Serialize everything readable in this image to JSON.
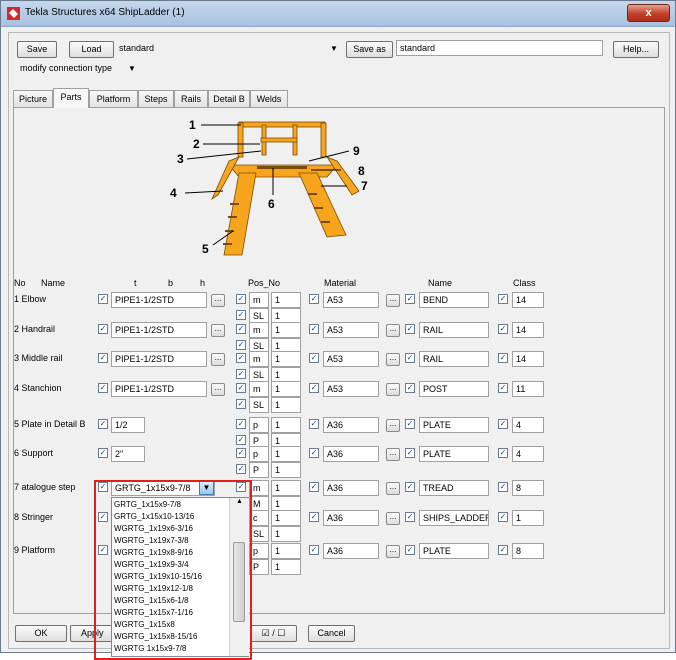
{
  "window": {
    "title": "Tekla Structures x64  ShipLadder (1)",
    "close_label": "x"
  },
  "toolbar": {
    "save_label": "Save",
    "load_label": "Load",
    "load_value": "standard",
    "save_as_label": "Save as",
    "save_as_value": "standard",
    "help_label": "Help...",
    "mode_value": "modify connection type"
  },
  "tabs": [
    "Picture",
    "Parts",
    "Platform",
    "Steps",
    "Rails",
    "Detail B",
    "Welds"
  ],
  "active_tab": "Parts",
  "diagram_labels": [
    "1",
    "2",
    "3",
    "4",
    "5",
    "6",
    "7",
    "8",
    "9"
  ],
  "headers": {
    "no": "No",
    "name": "Name",
    "t": "t",
    "b": "b",
    "h": "h",
    "pos_no": "Pos_No",
    "material": "Material",
    "part_name": "Name",
    "class": "Class"
  },
  "check_mark": "✓",
  "dots_label": "...",
  "rows": [
    {
      "label": "1 Elbow",
      "profile": "PIPE1-1/2STD",
      "p1": "m",
      "n1": "1",
      "p2": "SL",
      "n2": "1",
      "material": "A53",
      "name": "BEND",
      "class": "14"
    },
    {
      "label": "2 Handrail",
      "profile": "PIPE1-1/2STD",
      "p1": "m",
      "n1": "1",
      "p2": "SL",
      "n2": "1",
      "material": "A53",
      "name": "RAIL",
      "class": "14"
    },
    {
      "label": "3 Middle rail",
      "profile": "PIPE1-1/2STD",
      "p1": "m",
      "n1": "1",
      "p2": "SL",
      "n2": "1",
      "material": "A53",
      "name": "RAIL",
      "class": "14"
    },
    {
      "label": "4 Stanchion",
      "profile": "PIPE1-1/2STD",
      "p1": "m",
      "n1": "1",
      "p2": "SL",
      "n2": "1",
      "material": "A53",
      "name": "POST",
      "class": "11"
    },
    {
      "label": "5 Plate in Detail B",
      "profile": "1/2",
      "p1": "p",
      "n1": "1",
      "p2": "P",
      "n2": "1",
      "material": "A36",
      "name": "PLATE",
      "class": "4"
    },
    {
      "label": "6 Support",
      "profile": "2\"",
      "p1": "p",
      "n1": "1",
      "p2": "P",
      "n2": "1",
      "material": "A36",
      "name": "PLATE",
      "class": "4"
    },
    {
      "label": "7  atalogue step",
      "profile": "GRTG_1x15x9-7/8",
      "p1": "m",
      "n1": "1",
      "p2": "M",
      "n2": "1",
      "material": "A36",
      "name": "TREAD",
      "class": "8"
    },
    {
      "label": "8 Stringer",
      "profile": "",
      "p1": "c",
      "n1": "1",
      "p2": "SL",
      "n2": "1",
      "material": "A36",
      "name": "SHIPS_LADDER",
      "class": "1"
    },
    {
      "label": "9 Platform",
      "profile": "",
      "p1": "p",
      "n1": "1",
      "p2": "P",
      "n2": "1",
      "material": "A36",
      "name": "PLATE",
      "class": "8"
    }
  ],
  "dropdown_options": [
    "GRTG_1x15x9-7/8",
    "GRTG_1x15x10-13/16",
    "WGRTG_1x19x6-3/16",
    "WGRTG_1x19x7-3/8",
    "WGRTG_1x19x8-9/16",
    "WGRTG_1x19x9-3/4",
    "WGRTG_1x19x10-15/16",
    "WGRTG_1x19x12-1/8",
    "WGRTG_1x15x6-1/8",
    "WGRTG_1x15x7-1/16",
    "WGRTG_1x15x8",
    "WGRTG_1x15x8-15/16",
    "WGRTG 1x15x9-7/8"
  ],
  "bottom": {
    "ok_label": "OK",
    "apply_label": "Apply",
    "toggle_label": "☑ / ☐",
    "cancel_label": "Cancel"
  },
  "colors": {
    "accent_red": "#e0201b",
    "ladder_fill": "#f7a51c",
    "title_gradient": "#a9c1e0"
  }
}
